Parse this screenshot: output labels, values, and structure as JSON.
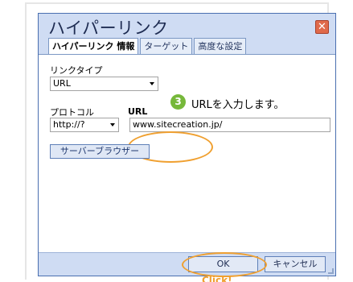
{
  "dialog": {
    "title": "ハイパーリンク",
    "close_icon": "close-icon",
    "tabs": [
      {
        "label": "ハイパーリンク 情報",
        "active": true
      },
      {
        "label": "ターゲット",
        "active": false
      },
      {
        "label": "高度な設定",
        "active": false
      }
    ]
  },
  "form": {
    "link_type_label": "リンクタイプ",
    "link_type_value": "URL",
    "protocol_label": "プロトコル",
    "protocol_value": "http://?",
    "url_label": "URL",
    "url_value": "www.sitecreation.jp/",
    "server_browser_label": "サーバーブラウザー"
  },
  "annotations": {
    "step_number": "3",
    "step_text": "URLを入力します。",
    "click_text": "Click!"
  },
  "footer": {
    "ok_label": "OK",
    "cancel_label": "キャンセル"
  },
  "colors": {
    "highlight": "#f0a030",
    "step_badge": "#76b83a",
    "titlebar": "#cfdcf3"
  }
}
